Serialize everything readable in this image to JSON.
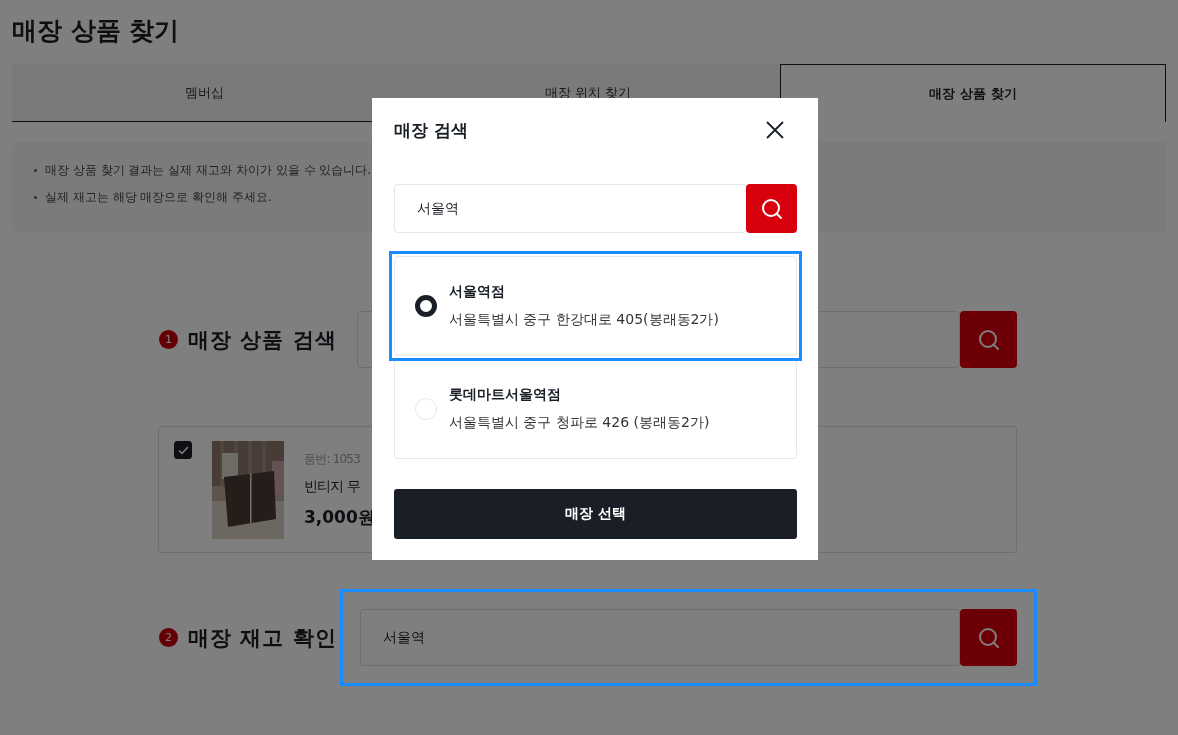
{
  "page_title": "매장 상품 찾기",
  "tabs": [
    {
      "label": "멤버십",
      "selected": false
    },
    {
      "label": "매장 위치 찾기",
      "selected": false
    },
    {
      "label": "매장 상품 찾기",
      "selected": true
    }
  ],
  "notices": [
    "매장 상품 찾기 결과는 실제 재고와 차이가 있을 수 있습니다.",
    "실제 재고는 해당 매장으로 확인해 주세요."
  ],
  "step_product_search": {
    "number": "1",
    "title": "매장 상품 검색"
  },
  "product": {
    "checked": true,
    "code": "품번: 1053",
    "name": "빈티지 무",
    "price": "3,000원"
  },
  "step_stock_check": {
    "number": "2",
    "title": "매장 재고 확인",
    "value": "서울역",
    "focused": true
  },
  "modal": {
    "title": "매장 검색",
    "search_value": "서울역",
    "stores": [
      {
        "name": "서울역점",
        "address": "서울특별시 중구 한강대로 405(봉래동2가)",
        "selected": true,
        "focused": true
      },
      {
        "name": "롯데마트서울역점",
        "address": "서울특별시 중구 청파로 426 (봉래동2가)",
        "selected": false,
        "focused": false
      }
    ],
    "button": "매장 선택"
  }
}
